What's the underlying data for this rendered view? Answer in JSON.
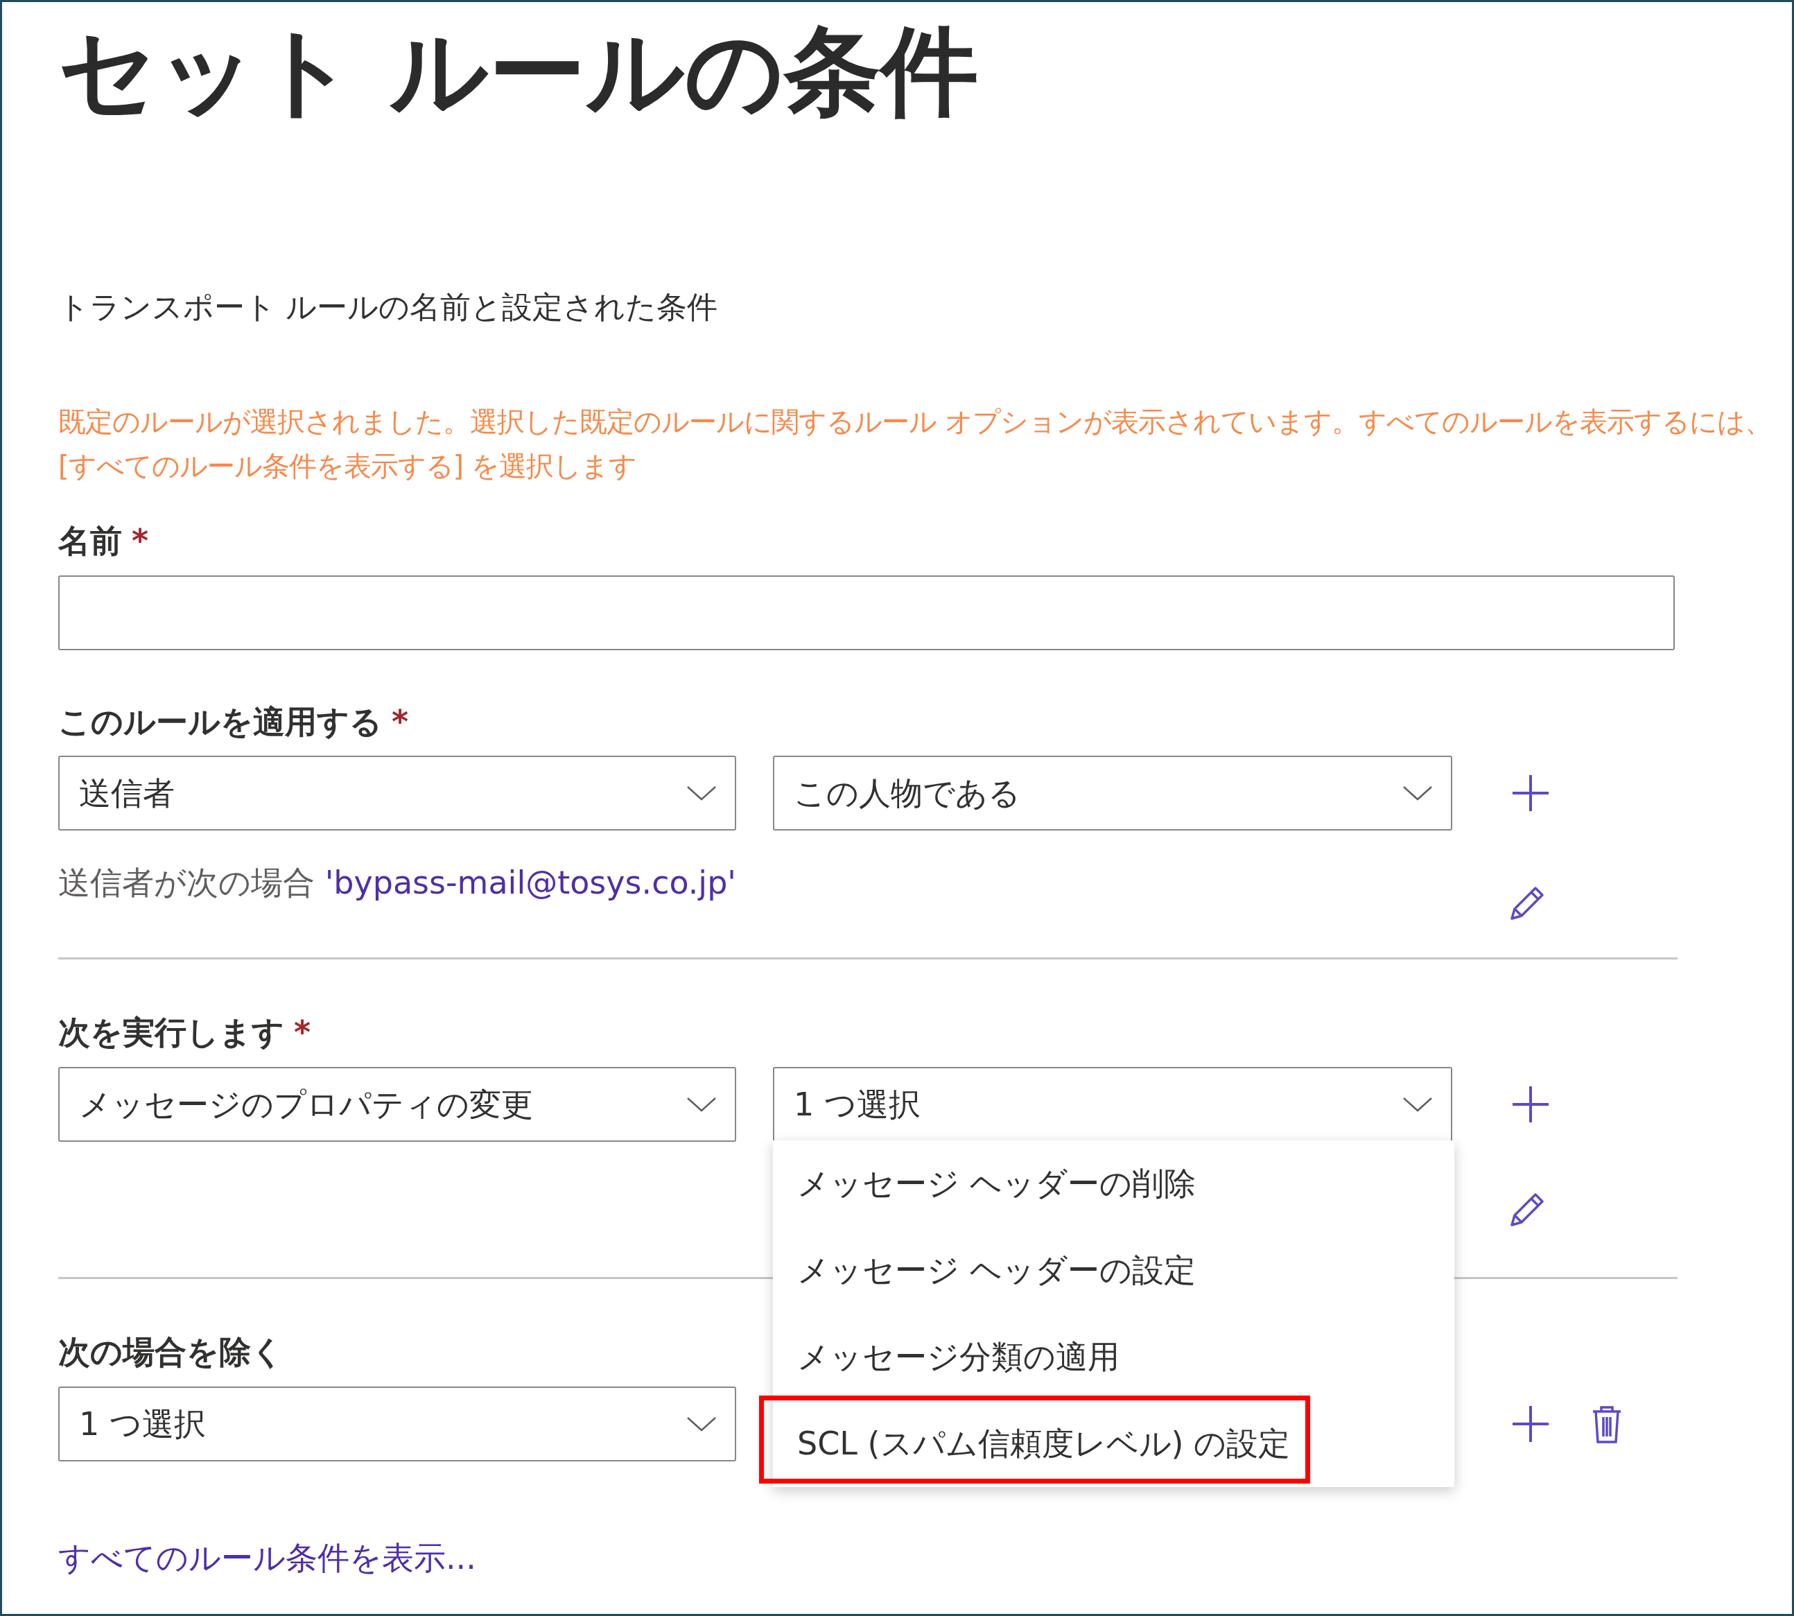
{
  "title": "セット ルールの条件",
  "subtitle": "トランスポート ルールの名前と設定された条件",
  "notice": "既定のルールが選択されました。選択した既定のルールに関するルール オプションが表示されています。すべてのルールを表示するには、[すべてのルール条件を表示する] を選択します",
  "required_mark": "*",
  "name_field": {
    "label": "名前",
    "required": true
  },
  "apply_rule": {
    "label": "このルールを適用する",
    "required": true,
    "selects": [
      {
        "value": "送信者"
      },
      {
        "value": "この人物である"
      }
    ],
    "condition": {
      "text": "送信者が次の場合",
      "value": "'bypass-mail@tosys.co.jp'"
    }
  },
  "do_action": {
    "label": "次を実行します",
    "required": true,
    "selects": [
      {
        "value": "メッセージのプロパティの変更"
      },
      {
        "value": "1 つ選択"
      }
    ],
    "menu": {
      "items": [
        {
          "label": "メッセージ ヘッダーの削除",
          "highlighted": false
        },
        {
          "label": "メッセージ ヘッダーの設定",
          "highlighted": false
        },
        {
          "label": "メッセージ分類の適用",
          "highlighted": false
        },
        {
          "label": "SCL (スパム信頼度レベル) の設定",
          "highlighted": true
        }
      ]
    }
  },
  "except": {
    "label": "次の場合を除く",
    "required": false,
    "selects": [
      {
        "value": "1 つ選択"
      }
    ]
  },
  "show_all_link": "すべてのルール条件を表示..."
}
